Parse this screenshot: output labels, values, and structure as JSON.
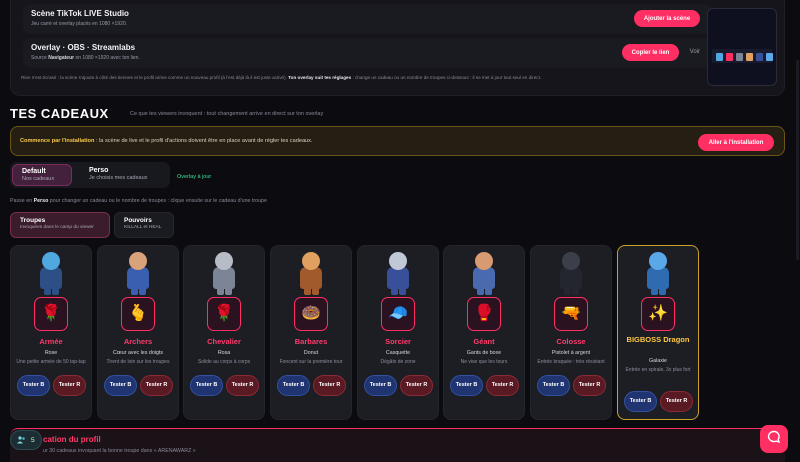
{
  "top": {
    "scene_title": "Scène TikTok LIVE Studio",
    "scene_sub": "Jeu carré et overlay placés en 1080 ×1920.",
    "scene_button": "Ajouter la scène",
    "overlay_title": "Overlay · OBS · Streamlabs",
    "overlay_sub_prefix": "Source",
    "overlay_sub_bold": "Navigateur",
    "overlay_sub_suffix": "en 1080 ×1920 avec ton lien.",
    "copy_button": "Copier le lien",
    "view_link": "Voir",
    "note_prefix": "Rien n'est écrasé : la scène s'ajoute à côté des tiennes et le profil arrive comme un nouveau profil (à l'est déjà là il est juste activé).",
    "note_bold": "Ton overlay suit tes réglages",
    "note_suffix": ": change un cadeau ou un nombre de troupes ci-dessous : il se met à jour tout seul en direct."
  },
  "section": {
    "title": "TES CADEAUX",
    "subtitle": "Ce que tes viewers invoquent : tout changement arrive en direct sur ton overlay"
  },
  "banner": {
    "bold": "Commence par l'installation",
    "text": ": la scène de live et le profil d'actions doivent être en place avant de régler tes cadeaux.",
    "button": "Aller à l'installation"
  },
  "tabs": [
    {
      "label": "Default",
      "sub": "Nos cadeaux"
    },
    {
      "label": "Perso",
      "sub": "Je choisis mes cadeaux"
    }
  ],
  "overlay_update": "Overlay à jour",
  "hint": {
    "prefix": "Passe en",
    "bold": "Perso",
    "suffix": "pour changer un cadeau ou le nombre de troupes : clique ensuite sur le cadeau d'une troupe"
  },
  "subtabs": [
    {
      "label": "Troupes",
      "sub": "Invoquées dans le camp du viewer"
    },
    {
      "label": "Pouvoirs",
      "sub": "KILLALL et HEAL"
    }
  ],
  "cards": [
    {
      "name": "Armée",
      "gift": "Rose",
      "desc": "Une petite armée de 50 tap-tap",
      "gift_icon": "rose-icon",
      "glyph": "🌹",
      "head": "#4fa8e0",
      "body": "#2c4f86"
    },
    {
      "name": "Archers",
      "gift": "Cœur avec les doigts",
      "desc": "Tirent de loin sur les troupes",
      "gift_icon": "finger-heart-icon",
      "glyph": "🫰",
      "head": "#d8a27a",
      "body": "#3b5fb0"
    },
    {
      "name": "Chevalier",
      "gift": "Rosa",
      "desc": "Solide au corps à corps",
      "gift_icon": "rose-icon",
      "glyph": "🌹",
      "head": "#b7bcc6",
      "body": "#7c8596"
    },
    {
      "name": "Barbares",
      "gift": "Donut",
      "desc": "Foncent sur la première tour",
      "gift_icon": "donut-icon",
      "glyph": "🍩",
      "head": "#e0a060",
      "body": "#a05a2c"
    },
    {
      "name": "Sorcier",
      "gift": "Casquette",
      "desc": "Dégâts de zone",
      "gift_icon": "cap-icon",
      "glyph": "🧢",
      "head": "#c0c8d8",
      "body": "#3a4f9a"
    },
    {
      "name": "Géant",
      "gift": "Gants de boxe",
      "desc": "Ne vise que les tours",
      "gift_icon": "boxing-gloves-icon",
      "glyph": "🥊",
      "head": "#d89a70",
      "body": "#4a6ab0"
    },
    {
      "name": "Colosse",
      "gift": "Pistolet à argent",
      "desc": "Entrée braquée : très résistant",
      "gift_icon": "money-gun-icon",
      "glyph": "🔫",
      "head": "#3a3f4a",
      "body": "#23262e"
    },
    {
      "name": "BIGBOSS Dragon",
      "gift": "Galaxie",
      "desc": "Entrée en spirale, 3x plus fort",
      "gift_icon": "galaxy-icon",
      "glyph": "✨",
      "head": "#5aa8e8",
      "body": "#2e6bb0"
    }
  ],
  "buttons": {
    "test_b": "Tester B",
    "test_r": "Tester R"
  },
  "bottom": {
    "title": "cation du profil",
    "sub": "ur 30 cadeaux invoquant la bonne troupe dans « ARENAWARZ »"
  },
  "users_count": "5",
  "colors": {
    "accent": "#ff2e63",
    "gold": "#ffc940",
    "green": "#3ee39a"
  }
}
